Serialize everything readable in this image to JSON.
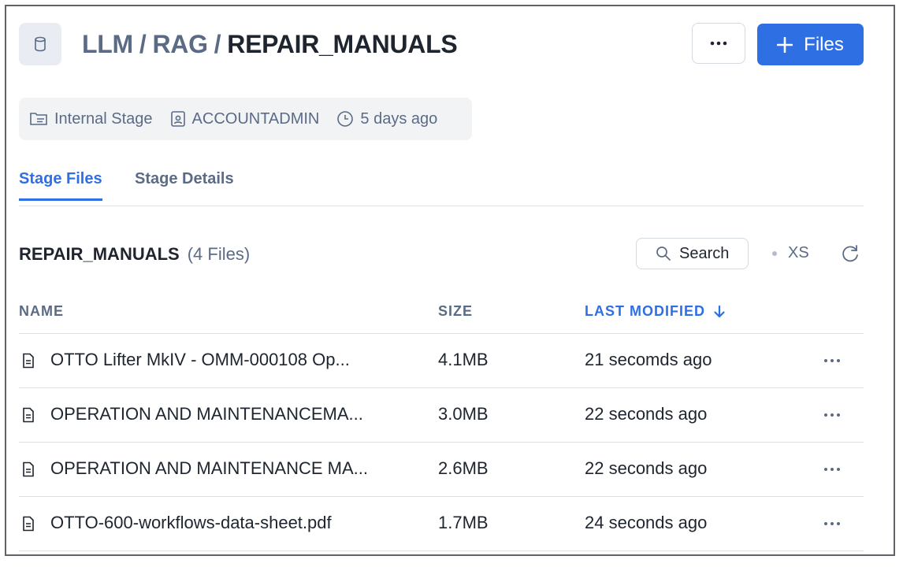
{
  "header": {
    "breadcrumb": [
      "LLM",
      "RAG"
    ],
    "separator": "/",
    "current": "REPAIR_MANUALS",
    "more_label": "...",
    "files_button_label": "Files"
  },
  "meta": {
    "stage_type": "Internal Stage",
    "owner": "ACCOUNTADMIN",
    "created": "5 days ago"
  },
  "tabs": [
    {
      "label": "Stage Files",
      "active": true
    },
    {
      "label": "Stage Details",
      "active": false
    }
  ],
  "list": {
    "title": "REPAIR_MANUALS",
    "count": "(4 Files)",
    "search_label": "Search",
    "size_option": "XS"
  },
  "table": {
    "headers": {
      "name": "NAME",
      "size": "SIZE",
      "modified": "LAST MODIFIED"
    },
    "sort": {
      "column": "modified",
      "direction": "desc"
    },
    "rows": [
      {
        "name": "OTTO Lifter MkIV - OMM-000108 Op...",
        "size": "4.1MB",
        "modified": "21 secomds ago"
      },
      {
        "name": "OPERATION AND MAINTENANCEMA...",
        "size": "3.0MB",
        "modified": "22 seconds ago"
      },
      {
        "name": "OPERATION AND MAINTENANCE MA...",
        "size": "2.6MB",
        "modified": "22 seconds ago"
      },
      {
        "name": "OTTO-600-workflows-data-sheet.pdf",
        "size": "1.7MB",
        "modified": "24 seconds ago"
      }
    ]
  },
  "colors": {
    "accent": "#2f6fe4",
    "muted": "#5b6b86",
    "text": "#1e252f"
  }
}
